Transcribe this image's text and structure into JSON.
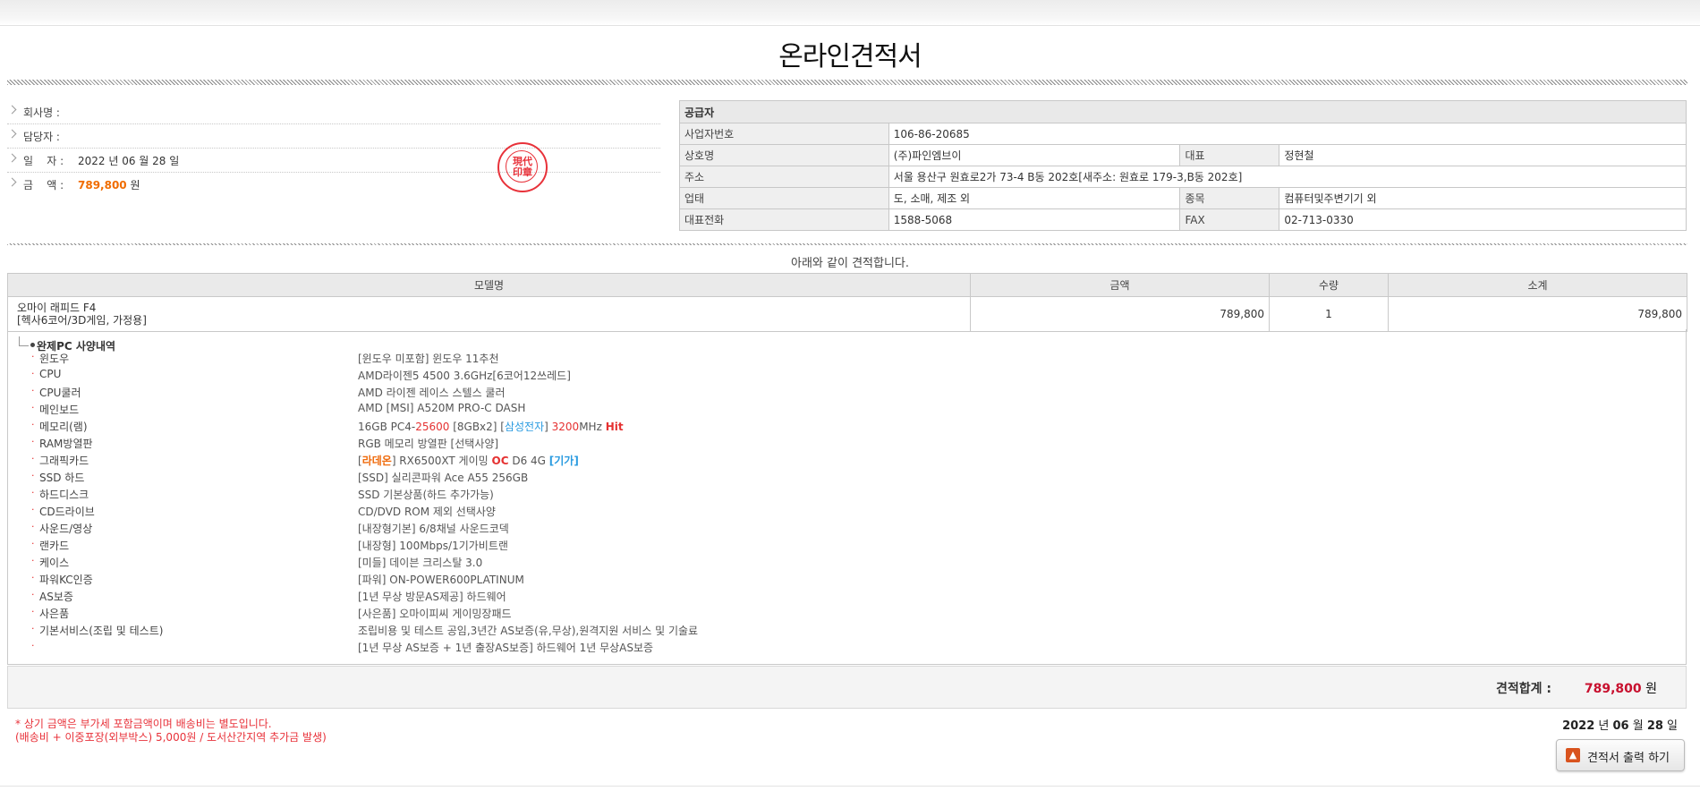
{
  "header": {
    "title": "온라인견적서"
  },
  "customer": {
    "company_label": "회사명 :",
    "manager_label": "담당자 :",
    "date_label": "일    자 :",
    "date_value": "2022 년 06 월 28 일",
    "amount_label": "금    액 :",
    "amount_value": "789,800",
    "amount_unit": " 원"
  },
  "stamp": {
    "line1": "現代",
    "line2": "印章"
  },
  "supplier": {
    "header": "공급자",
    "biz_no_label": "사업자번호",
    "biz_no": "106-86-20685",
    "name_label": "상호명",
    "name": "(주)파인엠브이",
    "ceo_label": "대표",
    "ceo": "정현철",
    "address_label": "주소",
    "address": "서울 용산구 원효로2가 73-4 B동 202호[새주소: 원효로 179-3,B동 202호]",
    "biz_type_label": "업태",
    "biz_type": "도, 소매, 제조 외",
    "biz_item_label": "종목",
    "biz_item": "컴퓨터및주변기기 외",
    "phone_label": "대표전화",
    "phone": "1588-5068",
    "fax_label": "FAX",
    "fax": "02-713-0330"
  },
  "intro_text": "아래와 같이 견적합니다.",
  "table": {
    "headers": [
      "모델명",
      "금액",
      "수량",
      "소계"
    ],
    "product_name": "오마이 래피드 F4",
    "product_sub": "[헥사6코어/3D게임, 가정용]",
    "price": "789,800",
    "qty": "1",
    "subtotal": "789,800"
  },
  "spec_header": "완제PC 사양내역",
  "specs": [
    {
      "k": "윈도우",
      "v": "[윈도우 미포함] 윈도우 11추천"
    },
    {
      "k": "CPU",
      "v": "AMD라이젠5 4500 3.6GHz[6코어12쓰레드]"
    },
    {
      "k": "CPU쿨러",
      "v": "AMD 라이젠 레이스 스텔스 쿨러"
    },
    {
      "k": "메인보드",
      "v": "AMD [MSI] A520M PRO-C DASH"
    },
    {
      "k": "메모리(램)"
    },
    {
      "k": "RAM방열판",
      "v": "RGB 메모리 방열판 [선택사양]"
    },
    {
      "k": "그래픽카드"
    },
    {
      "k": "SSD 하드",
      "v": "[SSD] 실리콘파워 Ace A55 256GB"
    },
    {
      "k": "하드디스크",
      "v": "SSD 기본상품(하드 추가가능)"
    },
    {
      "k": "CD드라이브",
      "v": "CD/DVD ROM 제외 선택사양"
    },
    {
      "k": "사운드/영상",
      "v": "[내장형기본] 6/8채널 사운드코덱"
    },
    {
      "k": "랜카드",
      "v": "[내장형] 100Mbps/1기가비트랜"
    },
    {
      "k": "케이스",
      "v": "[미들] 데이븐 크리스탈 3.0"
    },
    {
      "k": "파워KC인증",
      "v": "[파워] ON-POWER600PLATINUM"
    },
    {
      "k": "AS보증",
      "v": "[1년 무상 방문AS제공] 하드웨어"
    },
    {
      "k": "사은품",
      "v": "[사은품] 오마이피씨 게이밍장패드"
    },
    {
      "k": "기본서비스(조립 및 테스트)",
      "v": "조립비용 및 테스트 공임,3년간 AS보증(유,무상),원격지원 서비스 및 기술료"
    },
    {
      "k": "",
      "v": "[1년 무상 AS보증 + 1년 출장AS보증] 하드웨어 1년 무상AS보증"
    }
  ],
  "memory": {
    "a": "16GB PC4-",
    "b": "25600",
    "c": " [8GBx2] [",
    "d": "삼성전자",
    "e": "] ",
    "f": "3200",
    "g": "MHz ",
    "h": "Hit"
  },
  "gpu": {
    "a": "[",
    "b": "라데온",
    "c": "] RX6500XT 게이밍 ",
    "d": "OC",
    "e": " D6 4G ",
    "f": "[기가]"
  },
  "totals": {
    "label": "견적합계  :",
    "value": "789,800",
    "unit": " 원"
  },
  "notes": {
    "line1": "* 상기 금액은 부가세 포함금액이며 배송비는 별도입니다.",
    "line2": "(배송비 + 이중포장(외부박스) 5,000원 / 도서산간지역 추가금 발생)"
  },
  "date_footer": {
    "y": "2022",
    "y_u": " 년 ",
    "m": "06",
    "m_u": " 월 ",
    "d": "28",
    "d_u": " 일"
  },
  "print_button": {
    "icon": "▲",
    "label": "견적서 출력 하기"
  }
}
